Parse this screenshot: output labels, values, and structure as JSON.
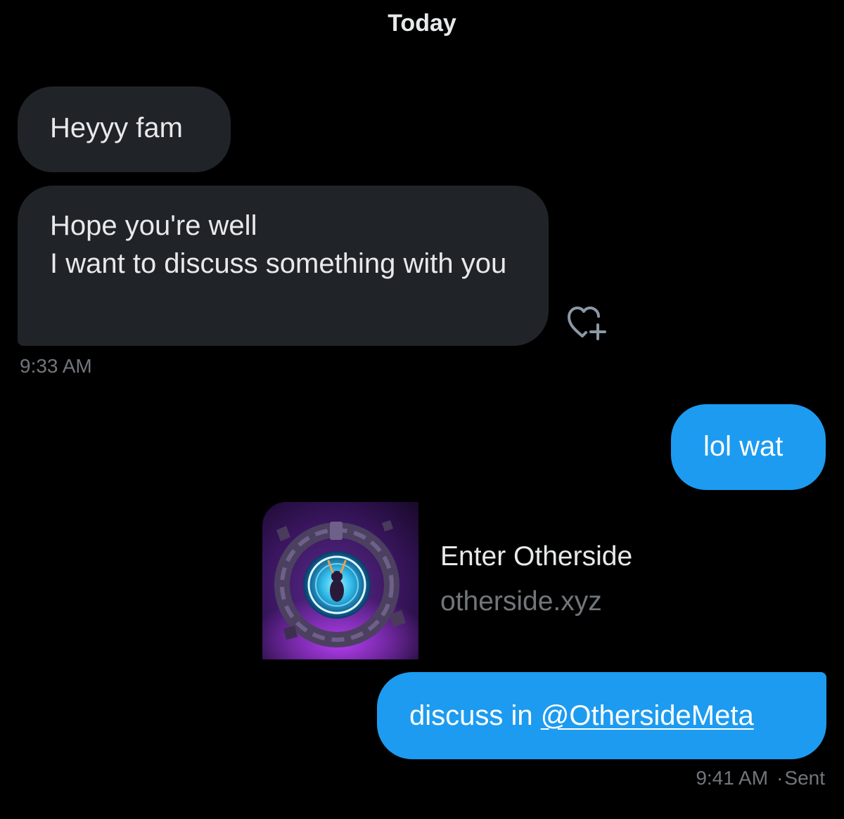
{
  "conversation": {
    "day_label": "Today",
    "messages": [
      {
        "id": "m1",
        "direction": "incoming",
        "text": "Heyyy fam"
      },
      {
        "id": "m2",
        "direction": "incoming",
        "text": "Hope you're well\nI want to discuss something with you",
        "timestamp": "9:33 AM",
        "reaction_icon": "add-reaction-heart-icon"
      },
      {
        "id": "m3",
        "direction": "outgoing",
        "text": "lol wat"
      },
      {
        "id": "m4",
        "direction": "outgoing",
        "type": "link-card",
        "title": "Enter Otherside",
        "domain": "otherside.xyz",
        "thumbnail_icon": "otherside-portal-thumbnail"
      },
      {
        "id": "m5",
        "direction": "outgoing",
        "text_prefix": "discuss in ",
        "mention": "@OthersideMeta",
        "timestamp": "9:41 AM",
        "status": "Sent"
      }
    ]
  },
  "colors": {
    "background": "#000000",
    "incoming_bubble": "#202327",
    "outgoing_bubble": "#1d9bf0",
    "primary_text": "#e7e9ea",
    "secondary_text": "#71767b"
  }
}
